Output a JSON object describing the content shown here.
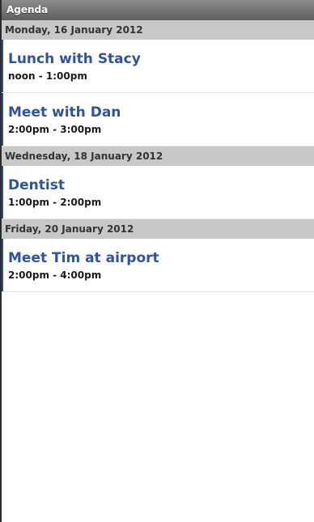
{
  "app": {
    "title": "Agenda"
  },
  "days": [
    {
      "header": "Monday, 16 January 2012",
      "events": [
        {
          "title": "Lunch with Stacy",
          "time": "noon - 1:00pm"
        },
        {
          "title": "Meet with Dan",
          "time": "2:00pm - 3:00pm"
        }
      ]
    },
    {
      "header": "Wednesday, 18 January 2012",
      "events": [
        {
          "title": "Dentist",
          "time": "1:00pm - 2:00pm"
        }
      ]
    },
    {
      "header": "Friday, 20 January 2012",
      "events": [
        {
          "title": "Meet Tim at airport",
          "time": "2:00pm - 4:00pm"
        }
      ]
    }
  ],
  "colors": {
    "title_bar": "#6f6f6f",
    "day_header": "#c8c8c8",
    "event_title": "#2e54a1",
    "event_bar": "#2e4f8f"
  }
}
